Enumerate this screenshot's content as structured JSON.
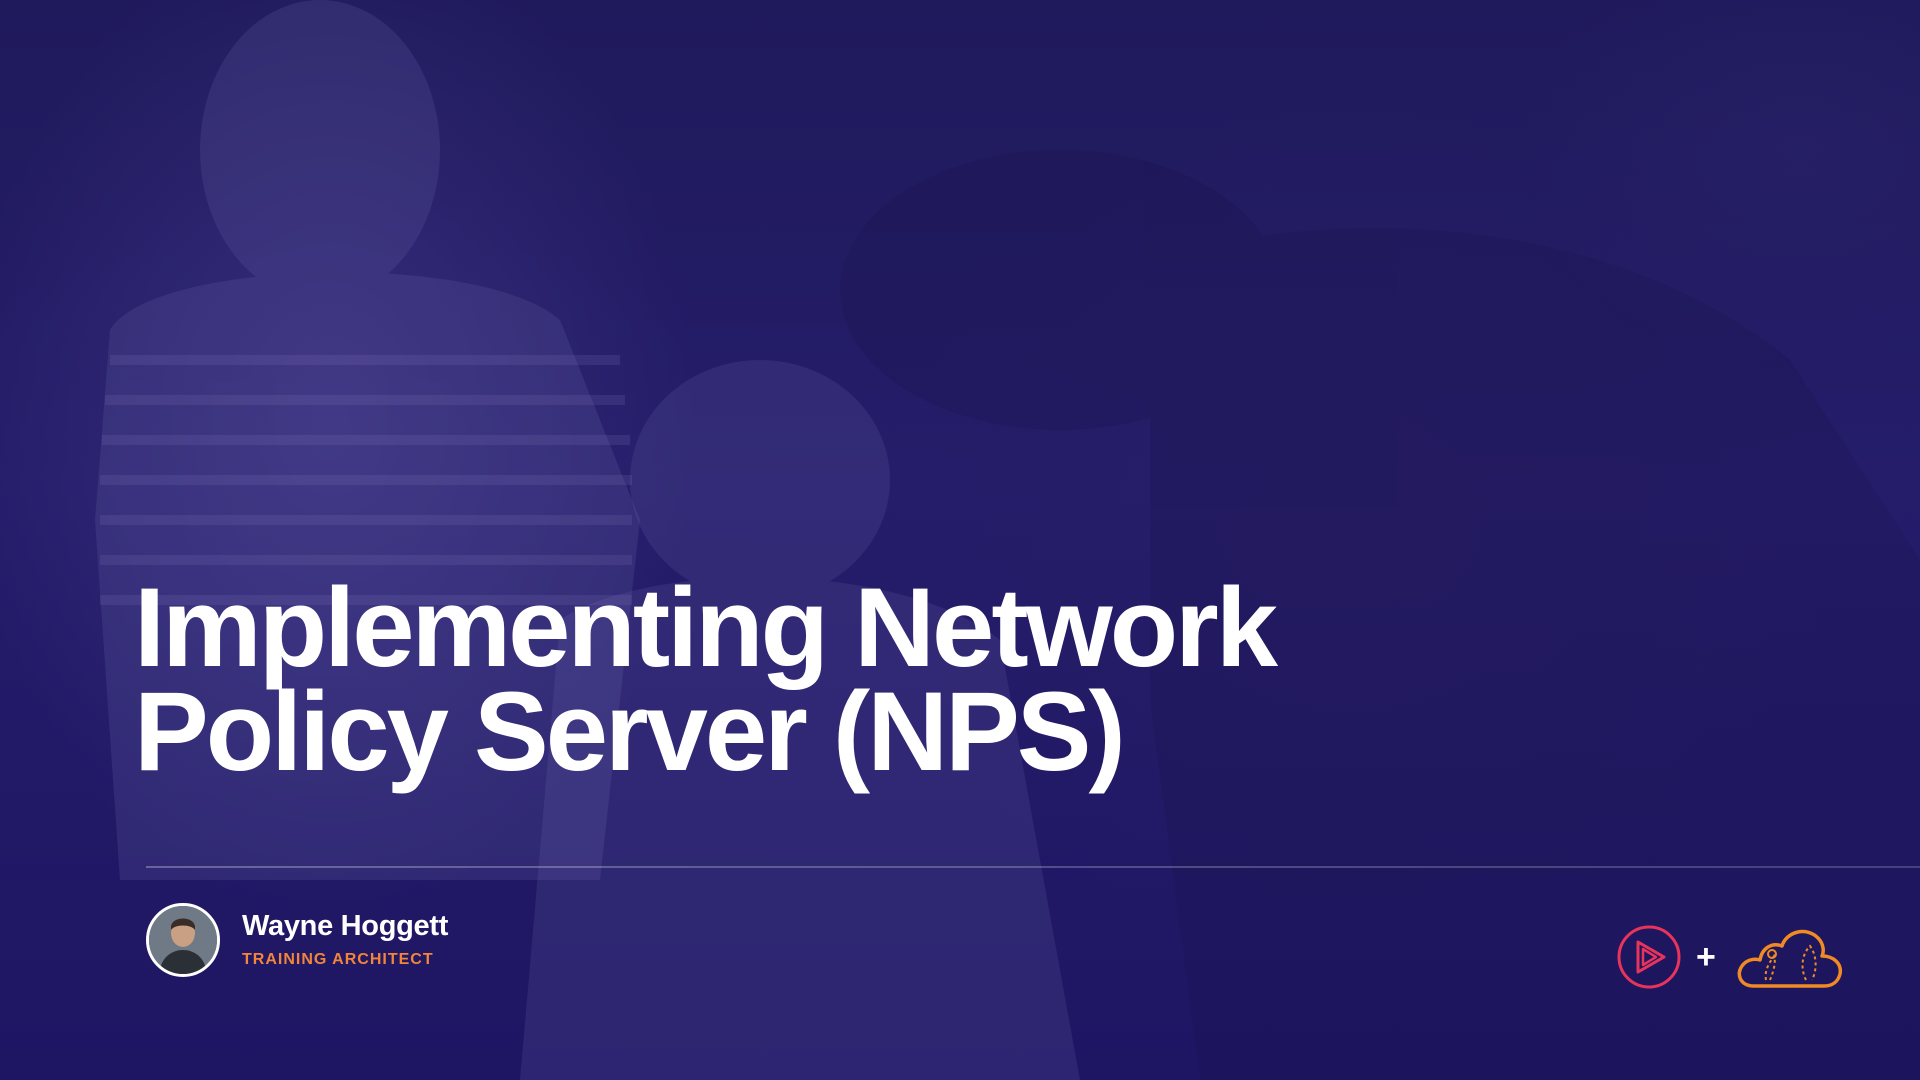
{
  "slide": {
    "title_lines": [
      "Implementing Network",
      "Policy Server (NPS)"
    ]
  },
  "instructor": {
    "name": "Wayne Hoggett",
    "role": "TRAINING ARCHITECT"
  },
  "branding": {
    "left_logo_icon": "play-triangle-logo-icon",
    "separator": "+",
    "right_logo_icon": "cloud-logo-icon"
  },
  "colors": {
    "background": "#1d1650",
    "title": "#ffffff",
    "role_accent": "#f2853a",
    "pluralsight_logo": "#e8345a",
    "cloud_logo": "#f08a24"
  }
}
